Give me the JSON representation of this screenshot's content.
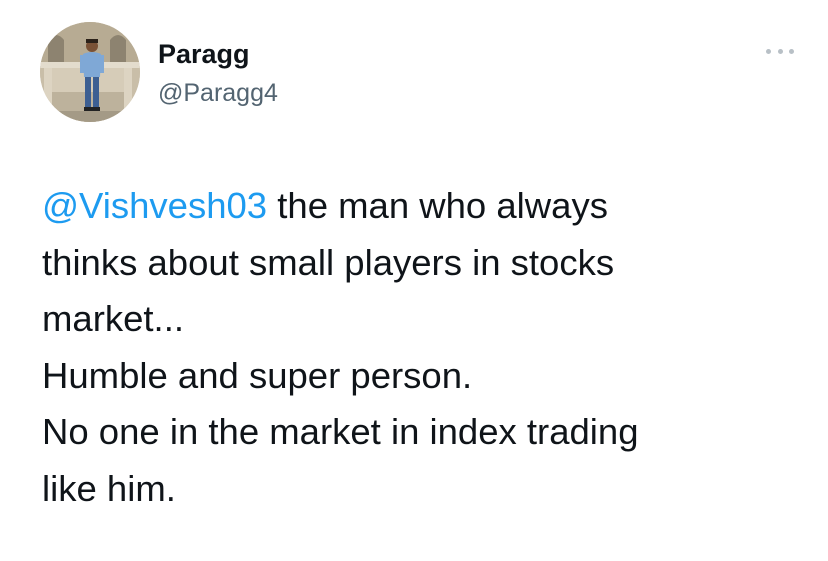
{
  "tweet": {
    "author": {
      "name": "Paragg",
      "handle": "@Paragg4"
    },
    "mention": "@Vishvesh03",
    "lines": [
      " the man who always",
      "thinks about small players in stocks",
      "market...",
      "Humble and super person.",
      "No one in the market in index trading",
      "like him."
    ]
  },
  "colors": {
    "text": "#0f1419",
    "handle": "#536471",
    "mention": "#1d9bf0",
    "more_dots": "#b8c0c6",
    "background": "#ffffff"
  },
  "icons": {
    "more": "more-horizontal-icon"
  }
}
